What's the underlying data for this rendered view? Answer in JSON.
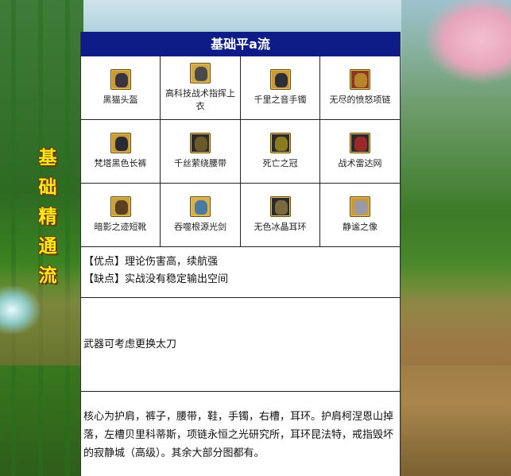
{
  "page": {
    "side_title": [
      "基",
      "础",
      "精",
      "通",
      "流"
    ],
    "panel_title": "基础平a流"
  },
  "equipment": [
    {
      "name": "黑猫头盔",
      "icon": "helmet-icon",
      "color": "#3a3440"
    },
    {
      "name": "高科技战术指挥上衣",
      "icon": "armor-top-icon",
      "color": "#4a4a4a"
    },
    {
      "name": "千里之音手镯",
      "icon": "bracelet-icon",
      "color": "#2e2e36"
    },
    {
      "name": "无尽的愤怒项链",
      "icon": "necklace-icon",
      "color": "#b8862a"
    },
    {
      "name": "梵塔黑色长裤",
      "icon": "pants-icon",
      "color": "#2a2a35"
    },
    {
      "name": "千丝萦绕腰带",
      "icon": "belt-icon",
      "color": "#6a5a2a"
    },
    {
      "name": "死亡之冠",
      "icon": "crown-icon",
      "color": "#8a7a20"
    },
    {
      "name": "战术雷达网",
      "icon": "radar-net-icon",
      "color": "#9a2a2a"
    },
    {
      "name": "暗影之迹短靴",
      "icon": "boots-icon",
      "color": "#5a4020"
    },
    {
      "name": "吞噬根源光剑",
      "icon": "lightsaber-icon",
      "color": "#4a7aa0"
    },
    {
      "name": "无色冰晶耳环",
      "icon": "earring-icon",
      "color": "#7a6a40"
    },
    {
      "name": "静谧之像",
      "icon": "statue-icon",
      "color": "#9a9aa6"
    }
  ],
  "pros": "【优点】理论伤害高，续航强",
  "cons": "【缺点】实战没有稳定输出空间",
  "weapon_note": "武器可考虑更换太刀",
  "core_text": "核心为护肩，裤子，腰带，鞋，手镯，右槽，耳环。护肩柯涅恩山掉落，左槽贝里科蒂斯，项链永恒之光研究所，耳环昆法特，戒指毁坏的寂静城（高级）。其余大部分图都有。"
}
